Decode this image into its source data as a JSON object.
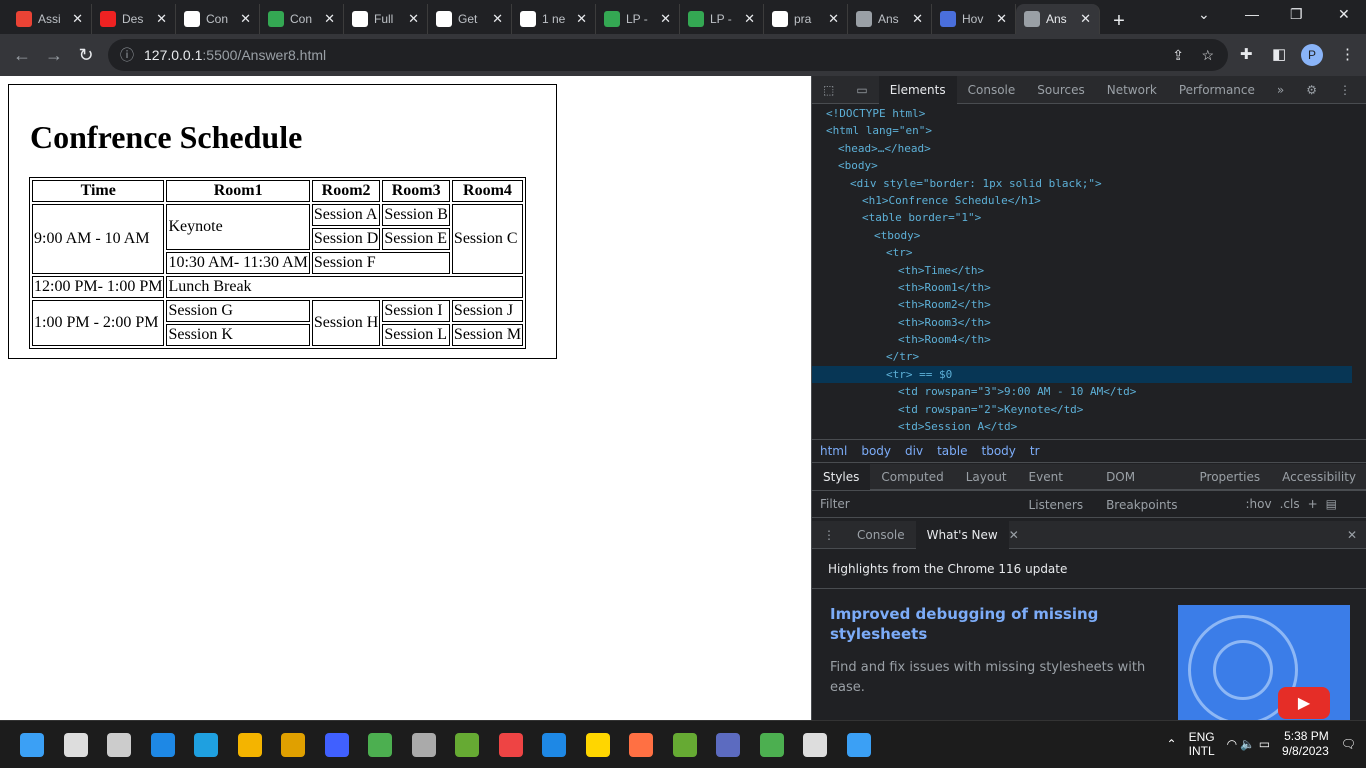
{
  "tabs": [
    {
      "title": "Assi",
      "favicon": "gmail-icon",
      "color": "#ea4335"
    },
    {
      "title": "Des",
      "favicon": "t-icon",
      "color": "#e22"
    },
    {
      "title": "Con",
      "favicon": "pw-icon",
      "color": "#fff"
    },
    {
      "title": "Con",
      "favicon": "drive-icon",
      "color": "#34a853"
    },
    {
      "title": "Full",
      "favicon": "pw-icon",
      "color": "#fff"
    },
    {
      "title": "Get",
      "favicon": "pw-icon",
      "color": "#fff"
    },
    {
      "title": "1 ne",
      "favicon": "pw-icon",
      "color": "#fff"
    },
    {
      "title": "LP -",
      "favicon": "drive-icon",
      "color": "#34a853"
    },
    {
      "title": "LP -",
      "favicon": "drive-icon",
      "color": "#34a853"
    },
    {
      "title": "pra",
      "favicon": "github-icon",
      "color": "#fff"
    },
    {
      "title": "Ans",
      "favicon": "globe-icon",
      "color": "#9aa0a6"
    },
    {
      "title": "Hov",
      "favicon": "w3-icon",
      "color": "#4a6fdc"
    },
    {
      "title": "Ans",
      "favicon": "globe-icon",
      "color": "#9aa0a6",
      "active": true
    }
  ],
  "address": {
    "host": "127.0.0.1",
    "path": ":5500/Answer8.html"
  },
  "profile_initial": "P",
  "page": {
    "heading": "Confrence Schedule",
    "headers": [
      "Time",
      "Room1",
      "Room2",
      "Room3",
      "Room4"
    ],
    "times": [
      "9:00 AM - 10 AM",
      "12:00 PM- 1:00 PM",
      "1:00 PM - 2:00 PM"
    ],
    "cells": {
      "keynote": "Keynote",
      "a": "Session A",
      "b": "Session B",
      "c": "Session C",
      "d": "Session D",
      "e": "Session E",
      "t1030": "10:30 AM- 11:30 AM",
      "f": "Session F",
      "lunch": "Lunch Break",
      "g": "Session G",
      "h": "Session H",
      "i": "Session I",
      "j": "Session J",
      "k": "Session K",
      "l": "Session L",
      "m": "Session M"
    }
  },
  "devtools": {
    "tabs": [
      "Elements",
      "Console",
      "Sources",
      "Network",
      "Performance"
    ],
    "dom": [
      "<!DOCTYPE html>",
      "<html lang=\"en\">",
      "<head>…</head>",
      "<body>",
      "<div style=\"border: 1px solid black;\">",
      "<h1>Confrence Schedule</h1>",
      "<table border=\"1\">",
      "<tbody>",
      "<tr>",
      "<th>Time</th>",
      "<th>Room1</th>",
      "<th>Room2</th>",
      "<th>Room3</th>",
      "<th>Room4</th>",
      "</tr>",
      "<tr> == $0",
      "<td rowspan=\"3\">9:00 AM - 10 AM</td>",
      "<td rowspan=\"2\">Keynote</td>",
      "<td>Session A</td>"
    ],
    "breadcrumbs": [
      "html",
      "body",
      "div",
      "table",
      "tbody",
      "tr"
    ],
    "style_tabs": [
      "Styles",
      "Computed",
      "Layout",
      "Event Listeners",
      "DOM Breakpoints",
      "Properties",
      "Accessibility"
    ],
    "filter_placeholder": "Filter",
    "hov": ":hov",
    "cls": ".cls",
    "drawer_tabs": [
      "Console",
      "What's New"
    ],
    "whats_new_heading": "Highlights from the Chrome 116 update",
    "card_title": "Improved debugging of missing stylesheets",
    "card_text": "Find and fix issues with missing stylesheets with ease."
  },
  "taskbar": {
    "lang1": "ENG",
    "lang2": "INTL",
    "time": "5:38 PM",
    "date": "9/8/2023"
  }
}
